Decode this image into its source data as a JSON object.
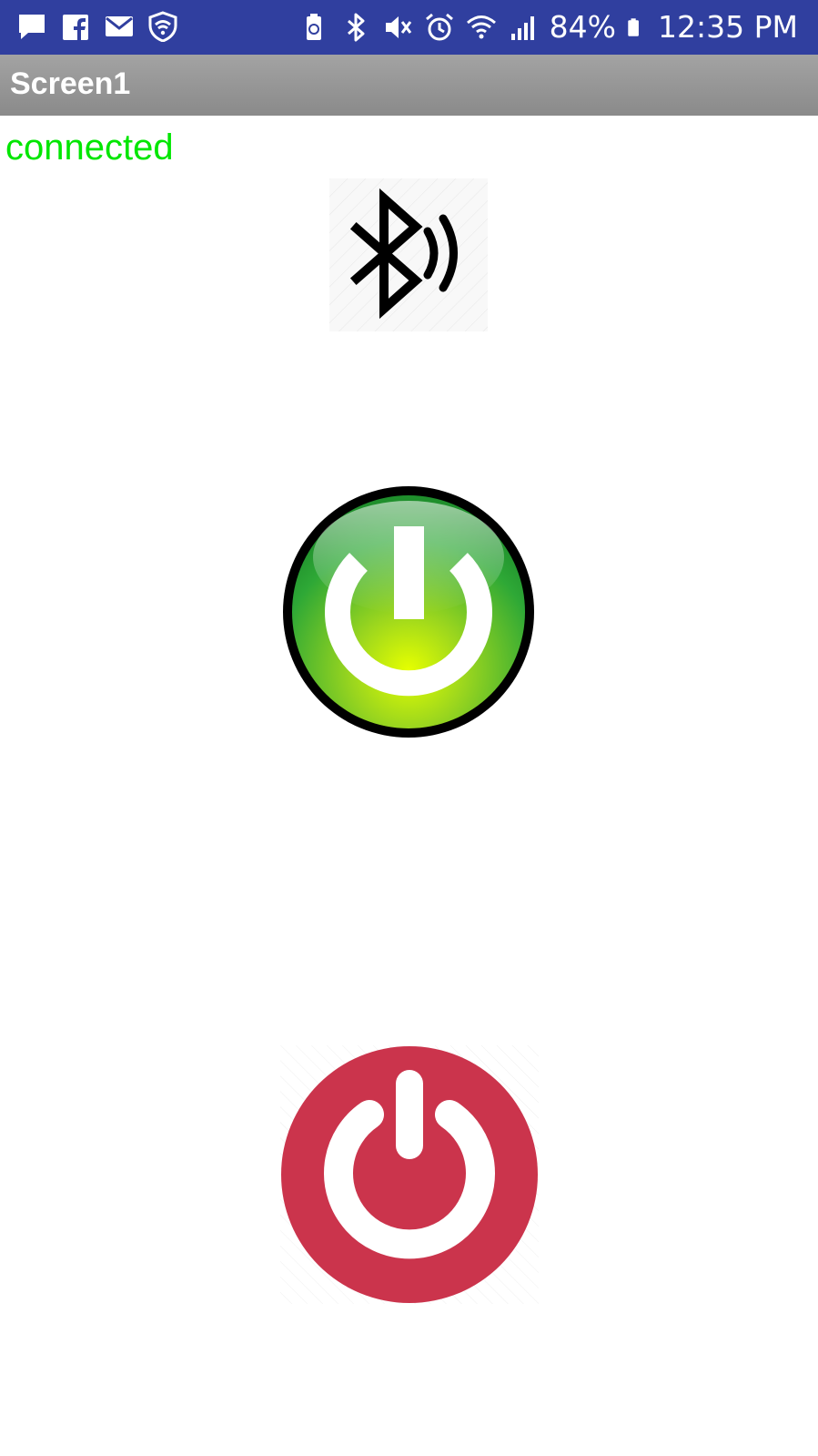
{
  "status_bar": {
    "left_icons": [
      "message-icon",
      "facebook-icon",
      "mail-icon",
      "shield-wifi-icon"
    ],
    "right_icons": [
      "battery-saver-icon",
      "bluetooth-icon",
      "mute-icon",
      "alarm-icon",
      "wifi-icon",
      "signal-icon",
      "battery-icon"
    ],
    "battery_percent": "84%",
    "time": "12:35 PM",
    "background": "#303f9f"
  },
  "title_bar": {
    "title": "Screen1"
  },
  "connection": {
    "status_text": "connected",
    "color": "#00e600"
  },
  "buttons": {
    "bluetooth": "bluetooth-connect-icon",
    "power_on": "power-on-green-icon",
    "power_off": "power-off-red-icon"
  }
}
